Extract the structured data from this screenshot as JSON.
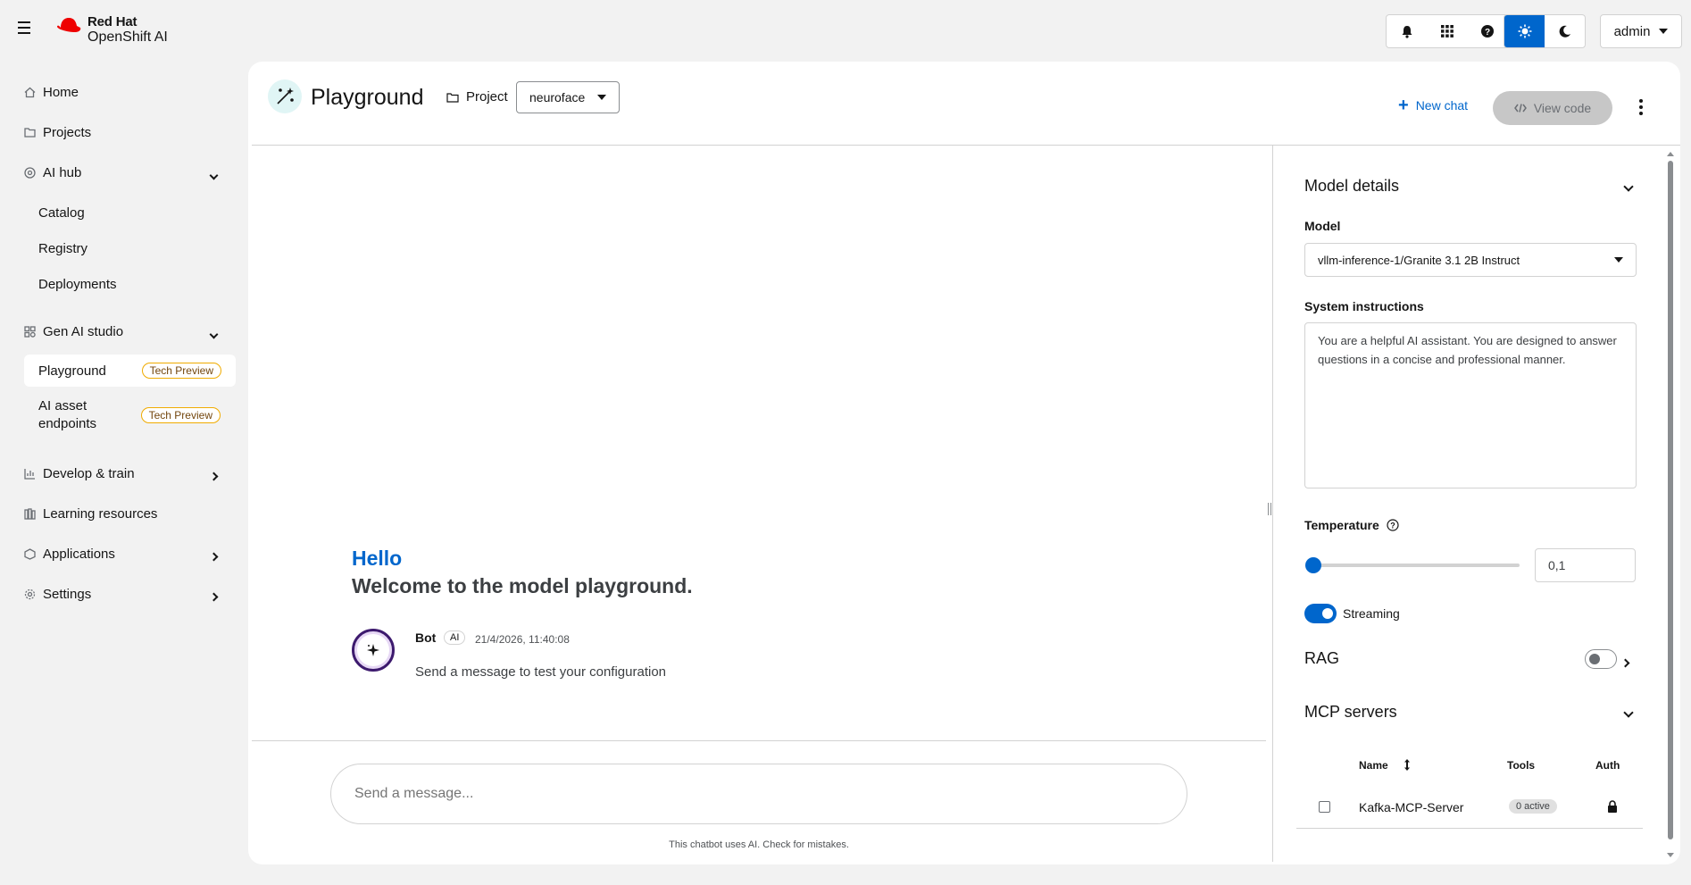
{
  "brand": {
    "line1": "Red Hat",
    "line2": "OpenShift AI"
  },
  "masthead": {
    "user": "admin"
  },
  "sidebar": {
    "home": "Home",
    "projects": "Projects",
    "ai_hub": "AI hub",
    "catalog": "Catalog",
    "registry": "Registry",
    "deployments": "Deployments",
    "gen_ai_studio": "Gen AI studio",
    "playground": "Playground",
    "ai_asset_endpoints_1": "AI asset",
    "ai_asset_endpoints_2": "endpoints",
    "tech_preview": "Tech Preview",
    "develop_train": "Develop & train",
    "learning_resources": "Learning resources",
    "applications": "Applications",
    "settings": "Settings"
  },
  "header": {
    "title": "Playground",
    "project_label": "Project",
    "project_value": "neuroface",
    "new_chat": "New chat",
    "view_code": "View code"
  },
  "chat": {
    "hello": "Hello",
    "welcome": "Welcome to the model playground.",
    "bot_name": "Bot",
    "bot_label": "AI",
    "bot_time": "21/4/2026, 11:40:08",
    "bot_message": "Send a message to test your configuration",
    "composer_placeholder": "Send a message...",
    "disclaimer": "This chatbot uses AI. Check for mistakes."
  },
  "panel": {
    "model_details": "Model details",
    "model_label": "Model",
    "model_value": "vllm-inference-1/Granite 3.1 2B Instruct",
    "system_instructions_label": "System instructions",
    "system_instructions_value": "You are a helpful AI assistant. You are designed to answer questions in a concise and professional manner.",
    "temperature_label": "Temperature",
    "temperature_value": "0,1",
    "streaming_label": "Streaming",
    "streaming_on": true,
    "rag_label": "RAG",
    "rag_on": false,
    "mcp_label": "MCP servers",
    "mcp_columns": {
      "name": "Name",
      "tools": "Tools",
      "auth": "Auth"
    },
    "mcp_rows": [
      {
        "name": "Kafka-MCP-Server",
        "tools": "0 active"
      }
    ]
  },
  "colors": {
    "accent": "#0066cc",
    "brand_red": "#ee0000",
    "tech_preview_border": "#f0ab00"
  }
}
